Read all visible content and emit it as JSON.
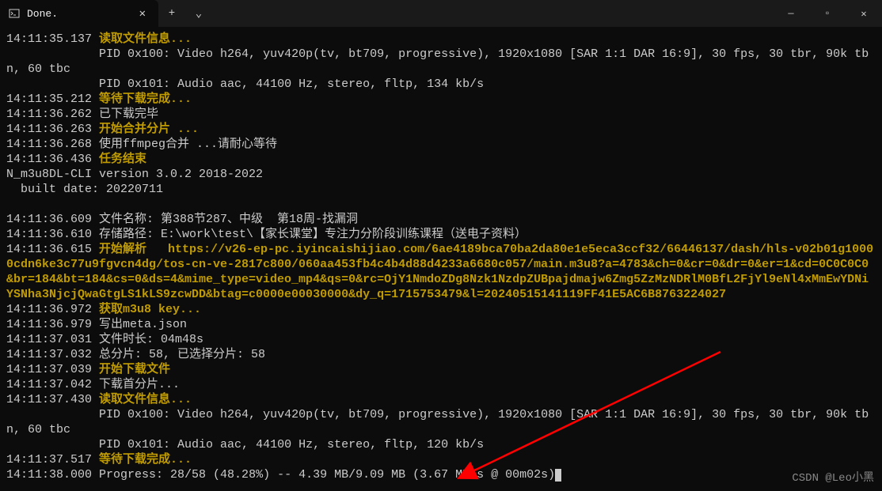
{
  "window": {
    "tab_title": "Done.",
    "tab_close": "✕",
    "new_tab": "+",
    "dropdown": "⌄",
    "min": "—",
    "max": "▫",
    "close": "✕"
  },
  "lines": [
    {
      "ts": "14:11:35.137",
      "y": true,
      "rest": " 读取文件信息..."
    },
    {
      "plain": "             PID 0x100: Video h264, yuv420p(tv, bt709, progressive), 1920x1080 [SAR 1:1 DAR 16:9], 30 fps, 30 tbr, 90k tbn, 60 tbc"
    },
    {
      "plain": "             PID 0x101: Audio aac, 44100 Hz, stereo, fltp, 134 kb/s"
    },
    {
      "ts": "14:11:35.212",
      "y": true,
      "rest": " 等待下载完成..."
    },
    {
      "ts": "14:11:36.262",
      "rest": " 已下载完毕"
    },
    {
      "ts": "14:11:36.263",
      "y": true,
      "rest": " 开始合并分片 ..."
    },
    {
      "ts": "14:11:36.268",
      "rest": " 使用ffmpeg合并 ...请耐心等待"
    },
    {
      "ts": "14:11:36.436",
      "y": true,
      "rest": " 任务结束"
    },
    {
      "plain": "N_m3u8DL-CLI version 3.0.2 2018-2022"
    },
    {
      "plain": "  built date: 20220711"
    },
    {
      "blank": true
    },
    {
      "ts": "14:11:36.609",
      "rest": " 文件名称: 第388节287、中级  第18周-找漏洞"
    },
    {
      "ts": "14:11:36.610",
      "rest": " 存储路径: E:\\work\\test\\【家长课堂】专注力分阶段训练课程（送电子资料）"
    },
    {
      "ts": "14:11:36.615",
      "y": true,
      "rest": " 开始解析   https://v26-ep-pc.iyincaishijiao.com/6ae4189bca70ba2da80e1e5eca3ccf32/66446137/dash/hls-v02b01g10000cdn6ke3c77u9fgvcn4dg/tos-cn-ve-2817c800/060aa453fb4c4b4d88d4233a6680c057/main.m3u8?a=4783&ch=0&cr=0&dr=0&er=1&cd=0C0C0C0&br=184&bt=184&cs=0&ds=4&mime_type=video_mp4&qs=0&rc=OjY1NmdoZDg8Nzk1NzdpZUBpajdmajw6Zmg5ZzMzNDRlM0BfL2FjYl9eNl4xMmEwYDNiYSNha3NjcjQwaGtgLS1kLS9zcwDD&btag=c0000e00030000&dy_q=1715753479&l=20240515141119FF41E5AC6B8763224027"
    },
    {
      "ts": "14:11:36.972",
      "y": true,
      "rest": " 获取m3u8 key..."
    },
    {
      "ts": "14:11:36.979",
      "rest": " 写出meta.json"
    },
    {
      "ts": "14:11:37.031",
      "rest": " 文件时长: 04m48s"
    },
    {
      "ts": "14:11:37.032",
      "rest": " 总分片: 58, 已选择分片: 58"
    },
    {
      "ts": "14:11:37.039",
      "y": true,
      "rest": " 开始下载文件"
    },
    {
      "ts": "14:11:37.042",
      "rest": " 下载首分片..."
    },
    {
      "ts": "14:11:37.430",
      "y": true,
      "rest": " 读取文件信息..."
    },
    {
      "plain": "             PID 0x100: Video h264, yuv420p(tv, bt709, progressive), 1920x1080 [SAR 1:1 DAR 16:9], 30 fps, 30 tbr, 90k tbn, 60 tbc"
    },
    {
      "plain": "             PID 0x101: Audio aac, 44100 Hz, stereo, fltp, 120 kb/s"
    },
    {
      "ts": "14:11:37.517",
      "y": true,
      "rest": " 等待下载完成..."
    },
    {
      "ts": "14:11:38.000",
      "rest": " Progress: 28/58 (48.28%) -- 4.39 MB/9.09 MB (3.67 MB/s @ 00m02s)",
      "cursor": true
    }
  ],
  "watermark": "CSDN @Leo小黑"
}
